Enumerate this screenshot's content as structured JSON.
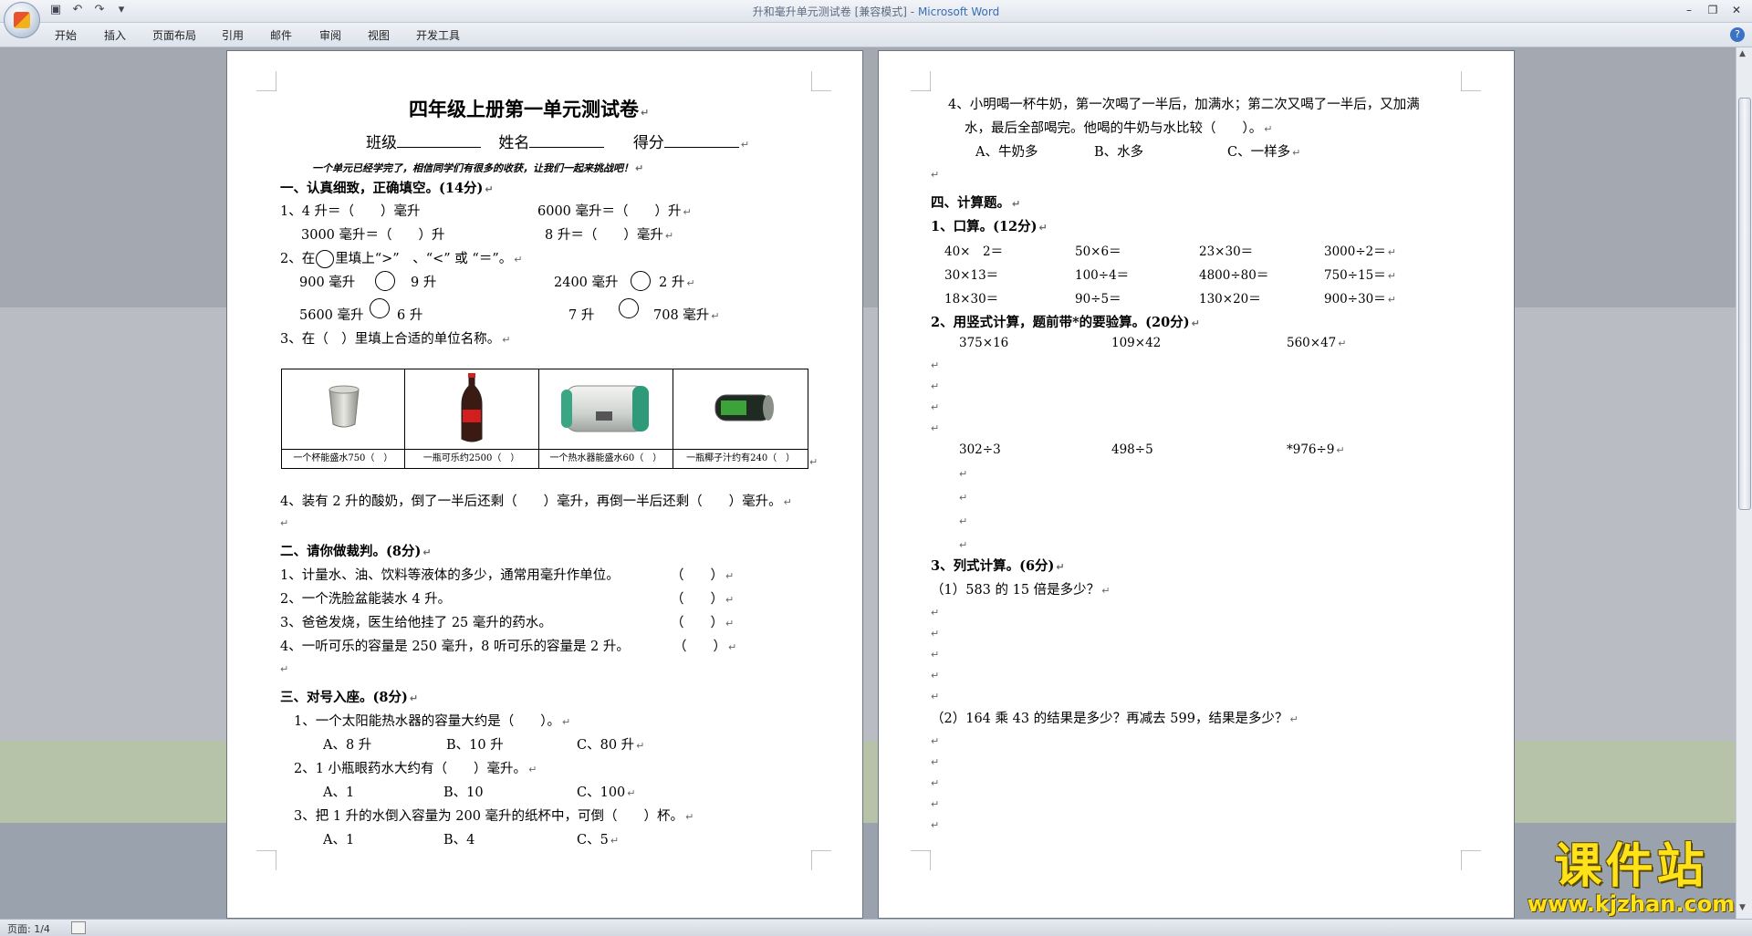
{
  "window": {
    "title_doc": "升和毫升单元测试卷 [兼容模式]",
    "title_sep": " - ",
    "title_app": "Microsoft Word"
  },
  "ribbon": {
    "tabs": [
      "开始",
      "插入",
      "页面布局",
      "引用",
      "邮件",
      "审阅",
      "视图",
      "开发工具"
    ]
  },
  "status": {
    "page": "页面: 1/4"
  },
  "watermark": {
    "big": "课件站",
    "small": "www.kjzhan.com"
  },
  "page1": {
    "title": "四年级上册第一单元测试卷",
    "info": {
      "class": "班级",
      "name": "姓名",
      "score": "得分"
    },
    "intro": "一个单元已经学完了，相信同学们有很多的收获，让我们一起来挑战吧！",
    "s1": {
      "heading": "一、认真细致，正确填空。(14分)",
      "q1a": "1、4 升＝（　　）毫升",
      "q1b": "6000 毫升＝（　　）升",
      "q1c": "3000 毫升＝（　　）升",
      "q1d": "8 升＝（　　）毫升",
      "q2": "2、在",
      "q2b": "里填上“>”　、“<” 或 “＝”。",
      "c1a": "900 毫升",
      "c1b": "9 升",
      "c1c": "2400 毫升",
      "c1d": "2 升",
      "c2a": "5600 毫升",
      "c2b": "6 升",
      "c2c": "7 升",
      "c2d": "708 毫升",
      "q3": "3、在（　）里填上合适的单位名称。",
      "captions": [
        "一个杯能盛水750（　）",
        "一瓶可乐约2500（　）",
        "一个热水器能盛水60（　）",
        "一瓶椰子汁约有240（　）"
      ],
      "q4": "4、装有 2 升的酸奶，倒了一半后还剩（　　）毫升，再倒一半后还剩（　　）毫升。"
    },
    "s2": {
      "heading": "二、请你做裁判。(8分)",
      "items": [
        "1、计量水、油、饮料等液体的多少，通常用毫升作单位。",
        "2、一个洗脸盆能装水 4 升。",
        "3、爸爸发烧，医生给他挂了 25 毫升的药水。",
        "4、一听可乐的容量是 250 毫升，8 听可乐的容量是 2 升。"
      ],
      "paren": "（　　）"
    },
    "s3": {
      "heading": "三、对号入座。(8分)",
      "q1": "1、一个太阳能热水器的容量大约是（　　）。",
      "q1opts": [
        "A、8 升",
        "B、10 升",
        "C、80 升"
      ],
      "q2": "2、1 小瓶眼药水大约有（　　）毫升。",
      "q2opts": [
        "A、1",
        "B、10",
        "C、100"
      ],
      "q3": "3、把 1 升的水倒入容量为 200 毫升的纸杯中，可倒（　　）杯。",
      "q3opts": [
        "A、1",
        "B、4",
        "C、5"
      ]
    }
  },
  "page2": {
    "q4a": "4、小明喝一杯牛奶，第一次喝了一半后，加满水；第二次又喝了一半后，又加满",
    "q4b": "水，最后全部喝完。他喝的牛奶与水比较（　　）。",
    "q4opts": [
      "A、牛奶多",
      "B、水多",
      "C、一样多"
    ],
    "s4": {
      "heading": "四、计算题。",
      "sub1": "1、口算。(12分)",
      "oral": [
        [
          "40×　2＝",
          "50×6＝",
          "23×30＝",
          "3000÷2＝"
        ],
        [
          "30×13＝",
          "100÷4＝",
          "4800÷80＝",
          "750÷15＝"
        ],
        [
          "18×30＝",
          "90÷5＝",
          "130×20＝",
          "900÷30＝"
        ]
      ],
      "sub2": "2、用竖式计算，题前带*的要验算。(20分)",
      "vert1": [
        "375×16",
        "109×42",
        "560×47"
      ],
      "vert2": [
        "302÷3",
        "498÷5",
        "*976÷9"
      ],
      "sub3": "3、列式计算。(6分)",
      "w1": "（1）583 的 15 倍是多少？",
      "w2": "（2）164 乘 43 的结果是多少？再减去 599，结果是多少？"
    }
  }
}
